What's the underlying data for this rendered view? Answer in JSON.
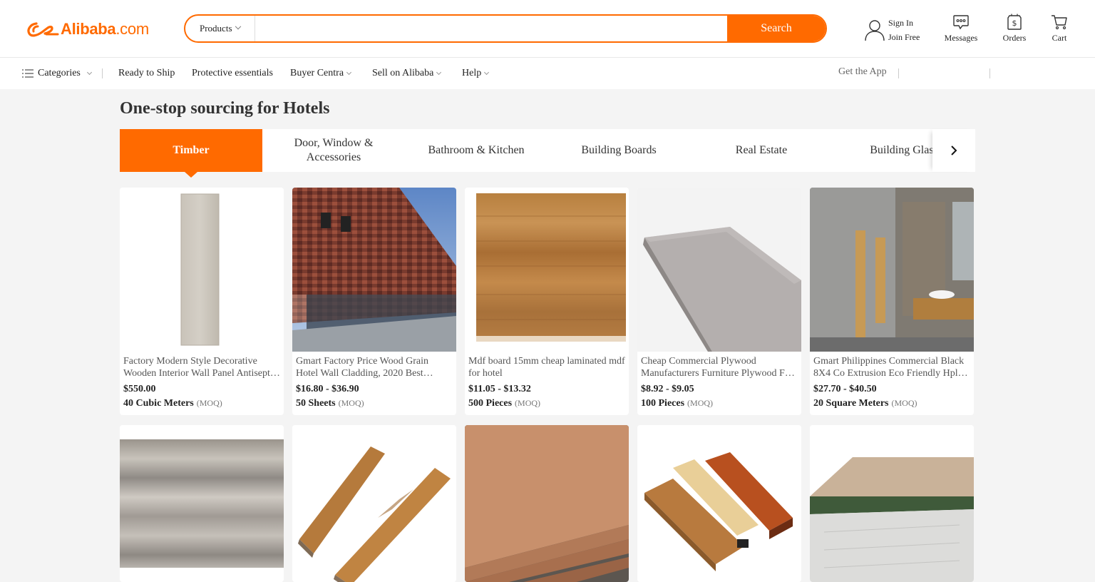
{
  "header": {
    "logo_brand": "Alibaba",
    "logo_suffix": ".com",
    "search_category": "Products",
    "search_placeholder": "",
    "search_button": "Search",
    "sign_in": "Sign In",
    "join_free": "Join Free",
    "messages": "Messages",
    "orders": "Orders",
    "cart": "Cart"
  },
  "nav": {
    "categories": "Categories",
    "ready_to_ship": "Ready to Ship",
    "protective": "Protective essentials",
    "buyer_central": "Buyer Centra",
    "sell": "Sell on Alibaba",
    "help": "Help",
    "get_app": "Get the App"
  },
  "page": {
    "title": "One-stop sourcing for Hotels"
  },
  "tabs": [
    {
      "label": "Timber",
      "active": true
    },
    {
      "label": "Door, Window & Accessories",
      "active": false
    },
    {
      "label": "Bathroom & Kitchen",
      "active": false
    },
    {
      "label": "Building Boards",
      "active": false
    },
    {
      "label": "Real Estate",
      "active": false
    },
    {
      "label": "Building Glass",
      "active": false
    }
  ],
  "products": [
    {
      "name": "Factory Modern Style Decorative Wooden Interior Wall Panel Antiseptic Wood",
      "price": "$550.00",
      "moq": "40 Cubic Meters",
      "moq_label": "(MOQ)"
    },
    {
      "name": "Gmart Factory Price Wood Grain Hotel Wall Cladding, 2020 Best Selling Panel",
      "price": "$16.80 - $36.90",
      "moq": "50 Sheets",
      "moq_label": "(MOQ)"
    },
    {
      "name": "Mdf board 15mm cheap laminated mdf for hotel",
      "price": "$11.05 - $13.32",
      "moq": "500 Pieces",
      "moq_label": "(MOQ)"
    },
    {
      "name": "Cheap Commercial Plywood Manufacturers Furniture Plywood For Hotel",
      "price": "$8.92 - $9.05",
      "moq": "100 Pieces",
      "moq_label": "(MOQ)"
    },
    {
      "name": "Gmart Philippines Commercial Black 8X4 Co Extrusion Eco Friendly Hpl Board",
      "price": "$27.70 - $40.50",
      "moq": "20 Square Meters",
      "moq_label": "(MOQ)"
    }
  ],
  "colors": {
    "accent": "#ff6a00"
  }
}
